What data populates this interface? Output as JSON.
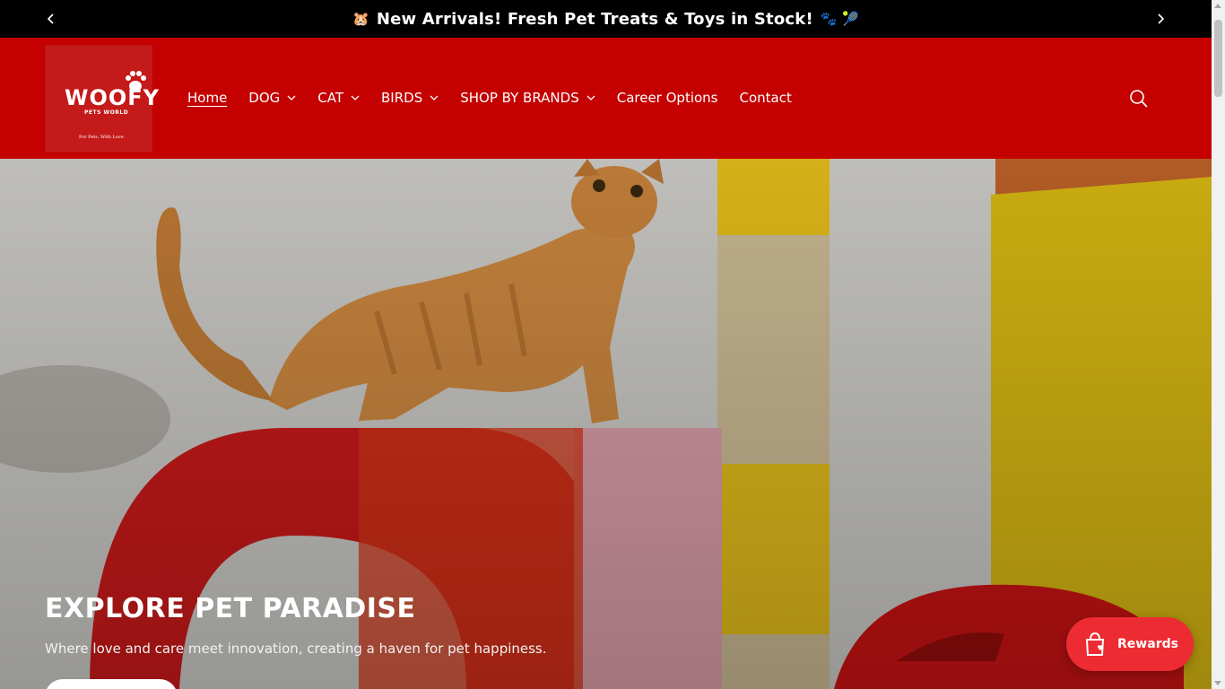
{
  "announcement": {
    "message": "New Arrivals! Fresh Pet Treats & Toys in Stock!",
    "leading_emoji": "🐹",
    "trailing_emoji": "🐾 🎾",
    "prev_icon": "chevron-left-icon",
    "next_icon": "chevron-right-icon"
  },
  "logo": {
    "word": "WOOFY",
    "subtitle": "PETS WORLD",
    "tagline": "For Pets, With Love."
  },
  "nav": {
    "items": [
      {
        "label": "Home",
        "active": true,
        "dropdown": false
      },
      {
        "label": "DOG",
        "active": false,
        "dropdown": true
      },
      {
        "label": "CAT",
        "active": false,
        "dropdown": true
      },
      {
        "label": "BIRDS",
        "active": false,
        "dropdown": true
      },
      {
        "label": "SHOP BY BRANDS",
        "active": false,
        "dropdown": true
      },
      {
        "label": "Career Options",
        "active": false,
        "dropdown": false
      },
      {
        "label": "Contact",
        "active": false,
        "dropdown": false
      }
    ],
    "search_icon": "search-icon"
  },
  "hero": {
    "title": "EXPLORE PET PARADISE",
    "subtitle": "Where love and care meet innovation, creating a haven for pet happiness."
  },
  "rewards": {
    "label": "Rewards",
    "icon": "shopping-bag-heart-icon"
  },
  "colors": {
    "header_red": "#c40000",
    "announcement_bg": "#000000",
    "rewards_red": "#ec2b33"
  }
}
